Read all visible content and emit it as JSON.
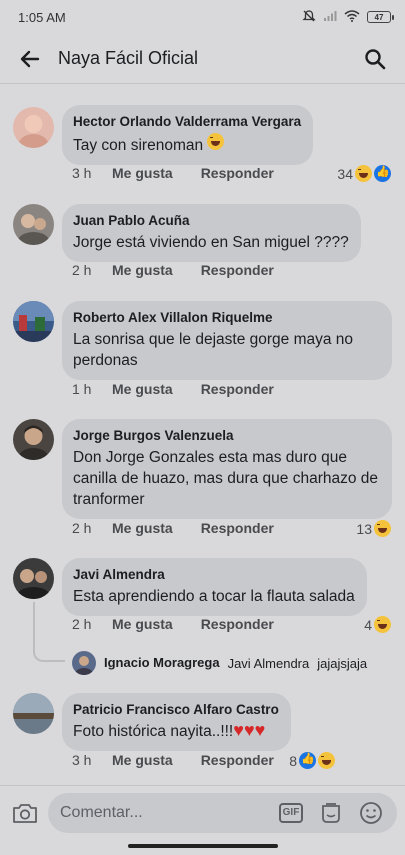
{
  "status_bar": {
    "time": "1:05 AM",
    "battery": "47"
  },
  "header": {
    "title": "Naya Fácil Oficial"
  },
  "comments": [
    {
      "author": "Hector Orlando Valderrama Vergara",
      "text": "Tay con  sirenoman",
      "time": "3 h",
      "like_label": "Me gusta",
      "reply_label": "Responder",
      "reaction_count": "34",
      "reactions": [
        "haha",
        "like"
      ],
      "avatar_color": "#e3b9ae"
    },
    {
      "author": "Juan Pablo Acuña",
      "text": "Jorge está viviendo en San miguel ????",
      "time": "2 h",
      "like_label": "Me gusta",
      "reply_label": "Responder",
      "avatar_color": "#8a8580"
    },
    {
      "author": "Roberto Alex Villalon Riquelme",
      "text": "La sonrisa que le  dejaste  gorge maya no perdonas",
      "time": "1 h",
      "like_label": "Me gusta",
      "reply_label": "Responder",
      "avatar_color": "#3a5a8a"
    },
    {
      "author": "Jorge Burgos Valenzuela",
      "text": "Don Jorge Gonzales esta mas duro que canilla de huazo, mas dura que charhazo de tranformer",
      "time": "2 h",
      "like_label": "Me gusta",
      "reply_label": "Responder",
      "reaction_count": "13",
      "reactions": [
        "haha"
      ],
      "avatar_color": "#4a4540"
    },
    {
      "author": "Javi Almendra",
      "text": "Esta aprendiendo a tocar la flauta salada",
      "time": "2 h",
      "like_label": "Me gusta",
      "reply_label": "Responder",
      "reaction_count": "4",
      "reactions": [
        "haha"
      ],
      "avatar_color": "#3b3b3b",
      "reply_preview": {
        "author": "Ignacio Moragrega",
        "mention": "Javi Almendra",
        "text": "jajajsjaja",
        "avatar_color": "#5a6a8a"
      }
    },
    {
      "author": "Patricio Francisco Alfaro Castro",
      "text": "Foto histórica nayita..!!!",
      "time": "3 h",
      "like_label": "Me gusta",
      "reply_label": "Responder",
      "reaction_count": "8",
      "reactions": [
        "like",
        "haha"
      ],
      "avatar_color": "#8a9aa8"
    }
  ],
  "composer": {
    "placeholder": "Comentar..."
  },
  "icons": {
    "back": "arrow-left-icon",
    "search": "search-icon",
    "camera": "camera-icon",
    "gif": "gif-icon",
    "sticker": "sticker-icon",
    "emoji": "emoji-icon"
  }
}
